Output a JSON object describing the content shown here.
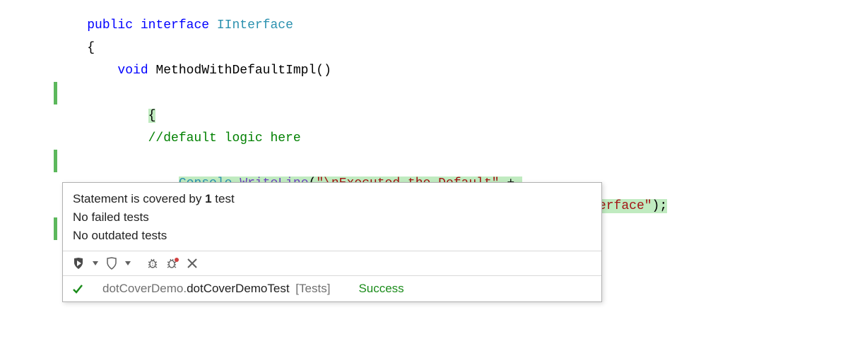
{
  "code": {
    "l1_public": "public",
    "l1_interface": "interface",
    "l1_type": "IInterface",
    "l2_brace": "{",
    "l3_void": "void",
    "l3_method": "MethodWithDefaultImpl",
    "l3_parens": "()",
    "l4_brace": "{",
    "l5_comment": "//default logic here",
    "l6_console": "Console",
    "l6_dot": ".",
    "l6_write": "WriteLine",
    "l6_open": "(",
    "l6_str": "\"\\nExecuted the Default\"",
    "l6_plus": " + ",
    "l7_str_tail": "nterface\"",
    "l7_close": ");"
  },
  "tooltip": {
    "line1_pre": "Statement is covered by ",
    "line1_count": "1",
    "line1_post": " test",
    "line2": "No failed tests",
    "line3": "No outdated tests",
    "footer_ns": "dotCoverDemo.",
    "footer_class": "dotCoverDemoTest",
    "footer_suffix": " [Tests]",
    "footer_status": "Success"
  }
}
